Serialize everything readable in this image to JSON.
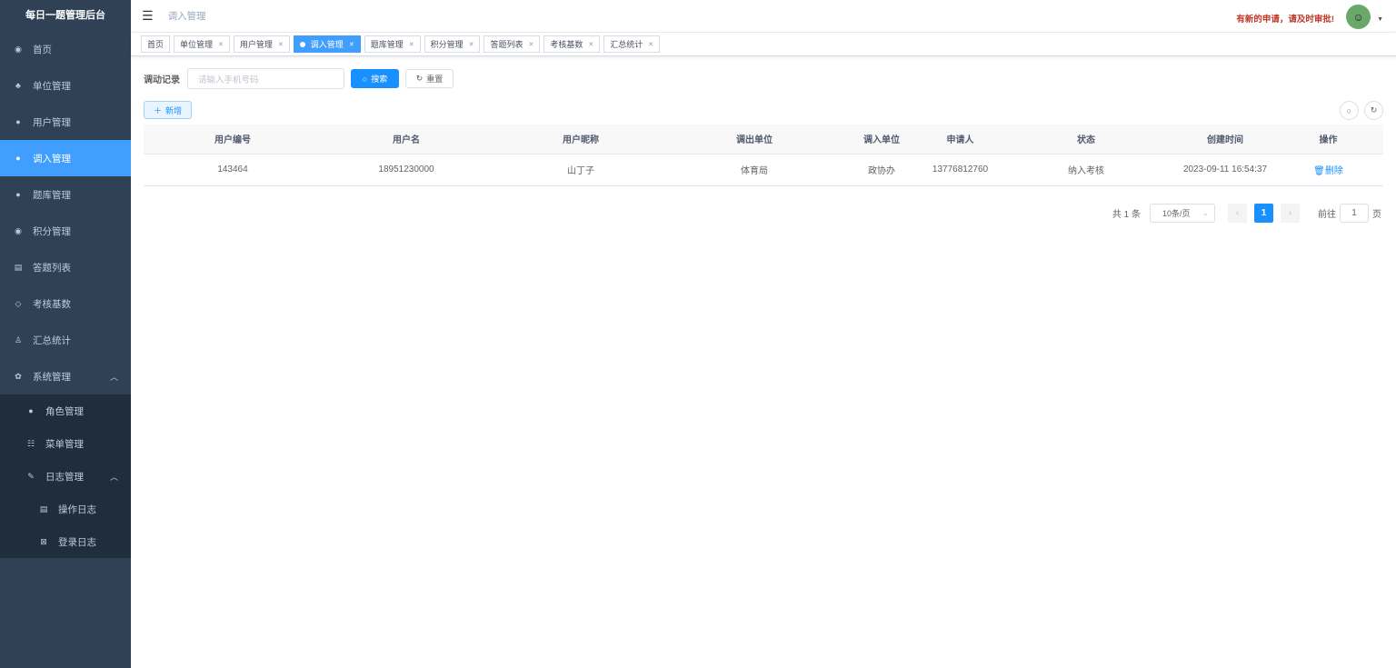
{
  "app_title": "每日一题管理后台",
  "sidebar": {
    "items": [
      {
        "label": "首页",
        "icon": "dashboard-icon",
        "glyph": "◉"
      },
      {
        "label": "单位管理",
        "icon": "tree-icon",
        "glyph": "♣"
      },
      {
        "label": "用户管理",
        "icon": "user-icon",
        "glyph": "●"
      },
      {
        "label": "调入管理",
        "icon": "peoples-icon",
        "glyph": "●"
      },
      {
        "label": "题库管理",
        "icon": "peoples-icon",
        "glyph": "●"
      },
      {
        "label": "积分管理",
        "icon": "dashboard-icon",
        "glyph": "◉"
      },
      {
        "label": "答题列表",
        "icon": "list-icon",
        "glyph": "▤"
      },
      {
        "label": "考核基数",
        "icon": "guide-icon",
        "glyph": "◇"
      },
      {
        "label": "汇总统计",
        "icon": "chart-icon",
        "glyph": "♙"
      }
    ],
    "system": {
      "label": "系统管理",
      "glyph": "✿",
      "children": [
        {
          "label": "角色管理",
          "glyph": "●"
        },
        {
          "label": "菜单管理",
          "glyph": "☷"
        }
      ],
      "log": {
        "label": "日志管理",
        "glyph": "✎",
        "children": [
          {
            "label": "操作日志",
            "glyph": "▤"
          },
          {
            "label": "登录日志",
            "glyph": "⊠"
          }
        ]
      }
    }
  },
  "header": {
    "breadcrumb": "调入管理",
    "notice": "有新的申请，请及时审批!"
  },
  "tags": [
    "首页",
    "单位管理",
    "用户管理",
    "调入管理",
    "题库管理",
    "积分管理",
    "答题列表",
    "考核基数",
    "汇总统计"
  ],
  "search": {
    "label": "调动记录",
    "placeholder": "请输入手机号码",
    "search_btn": "搜索",
    "reset_btn": "重置"
  },
  "add_btn": "新增",
  "table": {
    "columns": [
      "用户编号",
      "用户名",
      "用户昵称",
      "调出单位",
      "调入单位",
      "申请人",
      "状态",
      "创建时间",
      "操作"
    ],
    "rows": [
      [
        "143464",
        "18951230000",
        "山丁子",
        "体育局",
        "政协办",
        "13776812760",
        "纳入考核",
        "2023-09-11 16:54:37",
        "删除"
      ]
    ]
  },
  "pagination": {
    "total": "共 1 条",
    "page_size": "10条/页",
    "current": "1",
    "goto_label": "前往",
    "goto_value": "1",
    "page_suffix": "页"
  },
  "colors": {
    "sidebar": "#304156",
    "active": "#409eff",
    "primary": "#1890ff",
    "notice": "#c0392b"
  }
}
